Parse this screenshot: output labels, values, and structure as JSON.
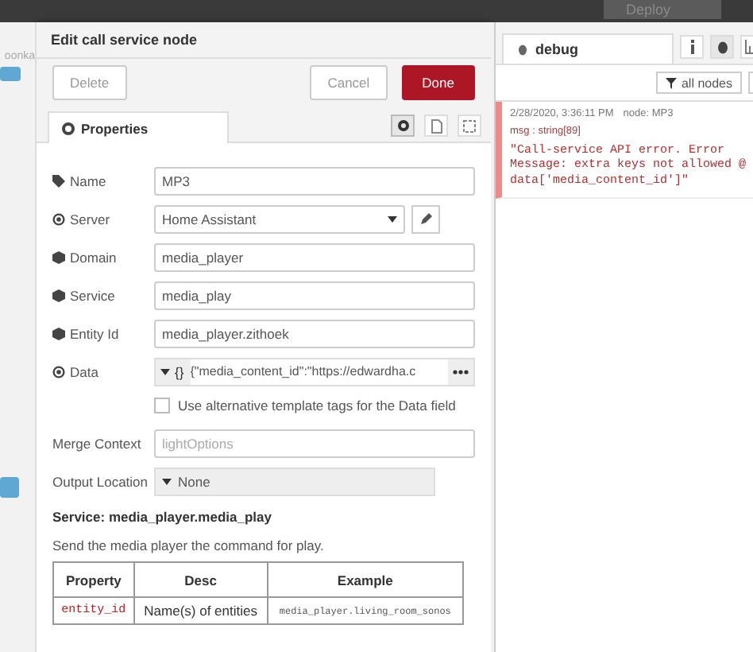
{
  "top_bar": {
    "deploy_label": "Deploy"
  },
  "canvas": {
    "tab_label": "oonka"
  },
  "dialog": {
    "title": "Edit call service node",
    "buttons": [
      {
        "label": "Delete",
        "kind": "plain"
      },
      {
        "label": "Cancel",
        "kind": "plain"
      },
      {
        "label": "Done",
        "kind": "primary"
      }
    ],
    "tabs": [
      {
        "label": "Properties",
        "selected": true
      }
    ],
    "fields": [
      {
        "label": "Name",
        "kind": "text",
        "value": "MP3"
      },
      {
        "label": "Server",
        "kind": "select",
        "value": "Home Assistant"
      },
      {
        "label": "Domain",
        "kind": "text",
        "value": "media_player"
      },
      {
        "label": "Service",
        "kind": "text",
        "value": "media_play"
      },
      {
        "label": "Entity Id",
        "kind": "text",
        "value": "media_player.zithoek"
      },
      {
        "label": "Data",
        "kind": "typed",
        "type_label": "{}",
        "value": "{\"media_content_id\":\"https://edwardha.c"
      },
      {
        "kind": "checkbox",
        "label": "Use alternative template tags for the Data field",
        "checked": false
      },
      {
        "label": "Merge Context",
        "kind": "text",
        "placeholder": "lightOptions"
      },
      {
        "label": "Output Location",
        "kind": "dropdown",
        "value": "None"
      }
    ],
    "service_heading": "Service: media_player.media_play",
    "service_description": "Send the media player the command for play.",
    "table": {
      "columns": [
        "Property",
        "Desc",
        "Example"
      ],
      "rows": [
        [
          "entity_id",
          "Name(s) of entities",
          "media_player.living_room_sonos"
        ]
      ]
    }
  },
  "debug": {
    "tab_label": "debug",
    "filter_label": "all nodes",
    "messages": [
      {
        "timestamp": "2/28/2020, 3:36:11 PM",
        "node": "node: MP3",
        "type": "msg : string[89]",
        "text": "\"Call-service API error. Error Message: extra keys not allowed @ data['media_content_id']\""
      }
    ]
  }
}
